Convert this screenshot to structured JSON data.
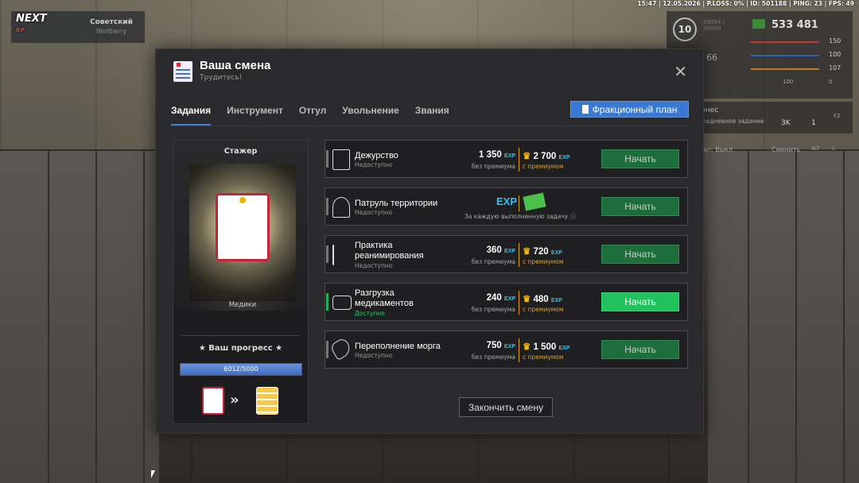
{
  "status_bar": "15:47 | 12.05.2026 | P.LOSS: 0% | ID: 501188 | PING: 23 | FPS: 49",
  "logo": {
    "main": "NEXT",
    "sub": "RP"
  },
  "server": {
    "name": "Советский",
    "sub": "Wolfberry"
  },
  "hud": {
    "level": "10",
    "exp_text": "29094 / 30000",
    "number": "66",
    "money": "533 481",
    "stats": [
      "150",
      "100",
      "107"
    ],
    "bottom": [
      "100",
      "0"
    ],
    "business_label": "знес",
    "daily_label": "ежедневное задание",
    "business_vals": [
      "3K",
      "1"
    ],
    "key_label": "F2",
    "voice_label": "ал: Выкл.",
    "change_label": "Сменить",
    "keys": [
      "ALT",
      "C"
    ]
  },
  "modal": {
    "title": "Ваша смена",
    "subtitle": "Трудитесь!",
    "tabs": [
      "Задания",
      "Инструмент",
      "Отгул",
      "Увольнение",
      "Звания"
    ],
    "plan_button": "Фракционный план",
    "finish_button": "Закончить смену"
  },
  "rank": {
    "name": "Стажер",
    "department": "Медики",
    "progress_title": "★ Ваш прогресс ★",
    "progress_text": "6012/5000",
    "progress_fraction": 1.0
  },
  "tasks": [
    {
      "name": "Дежурство",
      "status": "Недоступно",
      "exp": "1 350",
      "exp_label": "без премиума",
      "prem_exp": "2 700",
      "prem_label": "с премиумом",
      "button": "Начать",
      "available": false
    },
    {
      "name": "Патруль территории",
      "status": "Недоступно",
      "reward_note": "За каждую выполненную задачу",
      "button": "Начать",
      "available": false
    },
    {
      "name": "Практика реанимирования",
      "status": "Недоступно",
      "exp": "360",
      "exp_label": "без премиума",
      "prem_exp": "720",
      "prem_label": "с премиумом",
      "button": "Начать",
      "available": false
    },
    {
      "name": "Разгрузка медикаментов",
      "status": "Доступно",
      "exp": "240",
      "exp_label": "без премиума",
      "prem_exp": "480",
      "prem_label": "с премиумом",
      "button": "Начать",
      "available": true
    },
    {
      "name": "Переполнение морга",
      "status": "Недоступно",
      "exp": "750",
      "exp_label": "без премиума",
      "prem_exp": "1 500",
      "prem_label": "с премиумом",
      "button": "Начать",
      "available": false
    }
  ],
  "exp_word": "EXP",
  "colors": {
    "accent_blue": "#3a79d2",
    "button_green": "#21c25d",
    "premium_gold": "#e0a020",
    "exp_cyan": "#2fc3ff"
  }
}
